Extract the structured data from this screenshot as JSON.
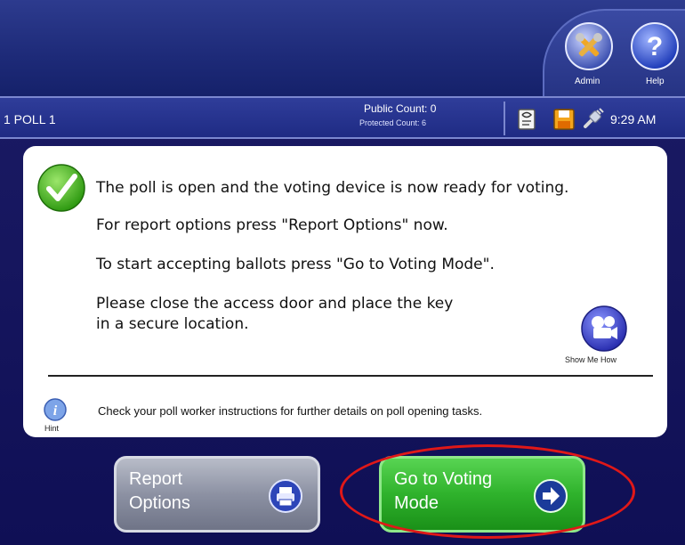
{
  "header": {
    "admin_label": "Admin",
    "help_label": "Help"
  },
  "statusbar": {
    "poll_name": "1 POLL 1",
    "public_count": "Public Count: 0",
    "protected_count": "Protected Count: 6",
    "time": "9:29 AM",
    "icons": [
      "report-document-icon",
      "save-disk-icon",
      "power-plug-icon"
    ]
  },
  "message": {
    "line1": "The poll is open and the voting device is now ready for voting.",
    "line2": "For report options press \"Report Options\" now.",
    "line3": "To start accepting ballots press \"Go to Voting Mode\".",
    "line4a": "Please close the access door and place the key",
    "line4b": "in a secure location.",
    "show_me_label": "Show Me How"
  },
  "hint": {
    "label": "Hint",
    "text": "Check your poll worker instructions for further details on poll opening tasks."
  },
  "buttons": {
    "report_line1": "Report",
    "report_line2": "Options",
    "vote_line1": "Go to Voting",
    "vote_line2": "Mode"
  },
  "colors": {
    "background": "#151a63",
    "panel": "#ffffff",
    "go_button": "#2fb22c",
    "report_button": "#8c91a3",
    "highlight_ellipse": "#e01818"
  }
}
